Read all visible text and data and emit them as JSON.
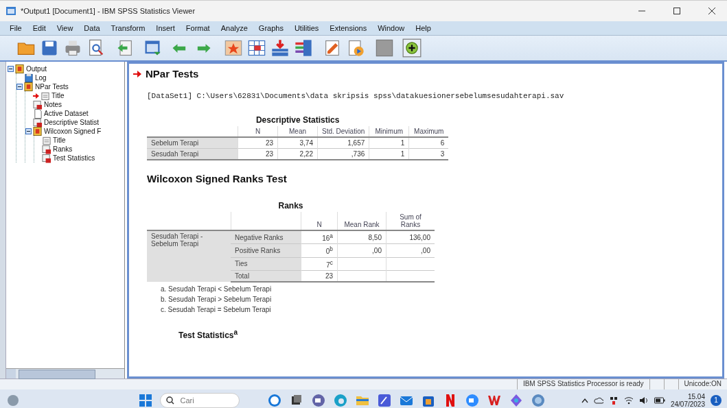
{
  "window": {
    "title": "*Output1 [Document1] - IBM SPSS Statistics Viewer"
  },
  "menu": [
    "File",
    "Edit",
    "View",
    "Data",
    "Transform",
    "Insert",
    "Format",
    "Analyze",
    "Graphs",
    "Utilities",
    "Extensions",
    "Window",
    "Help"
  ],
  "tree": [
    {
      "label": "Output",
      "kind": "book",
      "expanded": true,
      "selected": false,
      "children": [
        {
          "label": "Log",
          "kind": "log",
          "selected": false
        },
        {
          "label": "NPar Tests",
          "kind": "book",
          "expanded": true,
          "selected": false,
          "children": [
            {
              "label": "Title",
              "kind": "title",
              "selected": true
            },
            {
              "label": "Notes",
              "kind": "notes",
              "selected": false
            },
            {
              "label": "Active Dataset",
              "kind": "page",
              "selected": false
            },
            {
              "label": "Descriptive Statist",
              "kind": "table",
              "selected": false
            },
            {
              "label": "Wilcoxon Signed F",
              "kind": "book",
              "expanded": true,
              "selected": false,
              "children": [
                {
                  "label": "Title",
                  "kind": "title",
                  "selected": false
                },
                {
                  "label": "Ranks",
                  "kind": "table",
                  "selected": false
                },
                {
                  "label": "Test Statistics",
                  "kind": "table",
                  "selected": false
                }
              ]
            }
          ]
        }
      ]
    }
  ],
  "output": {
    "heading": "NPar Tests",
    "dataset_line": "[DataSet1] C:\\Users\\62831\\Documents\\data skripsis spss\\datakuesionersebelumsesudahterapi.sav",
    "descriptive": {
      "title": "Descriptive Statistics",
      "columns": [
        "N",
        "Mean",
        "Std. Deviation",
        "Minimum",
        "Maximum"
      ],
      "rows": [
        {
          "label": "Sebelum Terapi",
          "cells": [
            "23",
            "3,74",
            "1,657",
            "1",
            "6"
          ]
        },
        {
          "label": "Sesudah Terapi",
          "cells": [
            "23",
            "2,22",
            ",736",
            "1",
            "3"
          ]
        }
      ]
    },
    "wilcoxon_heading": "Wilcoxon Signed Ranks Test",
    "ranks": {
      "title": "Ranks",
      "columns": [
        "N",
        "Mean Rank",
        "Sum of Ranks"
      ],
      "group": "Sesudah Terapi - Sebelum Terapi",
      "rows": [
        {
          "label": "Negative Ranks",
          "cells": [
            "16$^{a}$",
            "8,50",
            "136,00"
          ]
        },
        {
          "label": "Positive Ranks",
          "cells": [
            "0$^{b}$",
            ",00",
            ",00"
          ]
        },
        {
          "label": "Ties",
          "cells": [
            "7$^{c}$"
          ]
        },
        {
          "label": "Total",
          "cells": [
            "23"
          ]
        }
      ],
      "footnotes": [
        "a. Sesudah Terapi < Sebelum Terapi",
        "b. Sesudah Terapi > Sebelum Terapi",
        "c. Sesudah Terapi = Sebelum Terapi"
      ]
    },
    "test_statistics_title": "Test Statistics$^{a}$"
  },
  "status_bar": [
    "IBM SPSS Statistics Processor is ready",
    "Unicode:ON"
  ],
  "taskbar": {
    "search_placeholder": "Cari",
    "time": "15.04",
    "date": "24/07/2023",
    "notification_count": "1"
  }
}
